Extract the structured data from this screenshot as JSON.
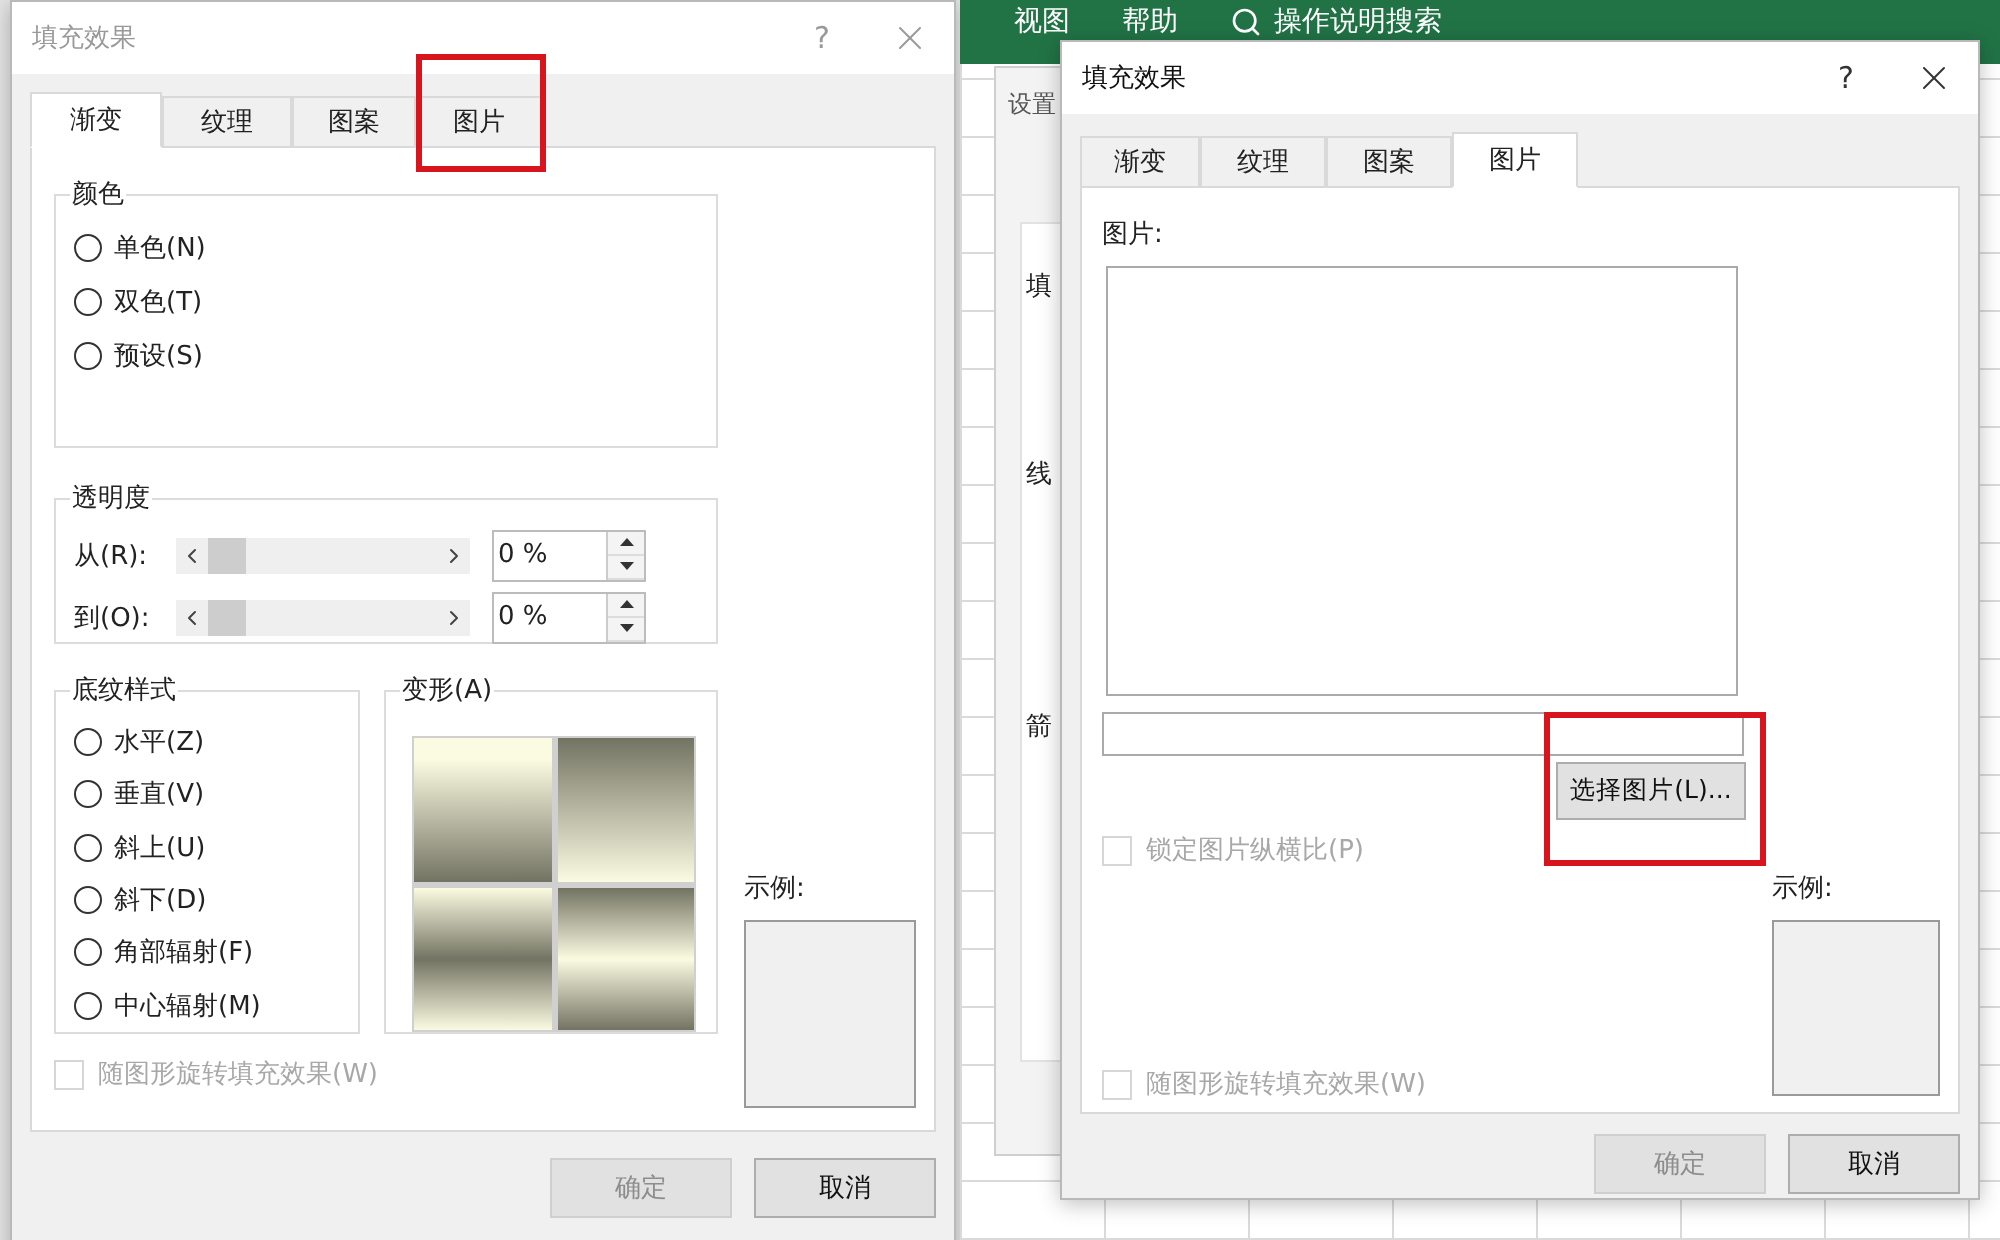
{
  "left_dialog": {
    "title": "填充效果",
    "active": false,
    "help": "?",
    "tabs": [
      {
        "label": "渐变",
        "selected": true,
        "highlighted": false
      },
      {
        "label": "纹理",
        "selected": false,
        "highlighted": false
      },
      {
        "label": "图案",
        "selected": false,
        "highlighted": false
      },
      {
        "label": "图片",
        "selected": false,
        "highlighted": true
      }
    ],
    "colors": {
      "title": "颜色",
      "options": [
        {
          "label": "单色(N)",
          "selected": false
        },
        {
          "label": "双色(T)",
          "selected": false
        },
        {
          "label": "预设(S)",
          "selected": false
        }
      ]
    },
    "transparency": {
      "title": "透明度",
      "rows": [
        {
          "label": "从(R):",
          "level": 0,
          "value": "0 %"
        },
        {
          "label": "到(O):",
          "level": 0,
          "value": "0 %"
        }
      ]
    },
    "shading_styles": {
      "title": "底纹样式",
      "options": [
        {
          "label": "水平(Z)",
          "selected": false
        },
        {
          "label": "垂直(V)",
          "selected": false
        },
        {
          "label": "斜上(U)",
          "selected": false
        },
        {
          "label": "斜下(D)",
          "selected": false
        },
        {
          "label": "角部辐射(F)",
          "selected": false
        },
        {
          "label": "中心辐射(M)",
          "selected": false
        }
      ]
    },
    "variants": {
      "title": "变形(A)"
    },
    "sample": {
      "label": "示例:"
    },
    "rotate_checkbox": {
      "label": "随图形旋转填充效果(W)",
      "checked": false,
      "disabled": true
    },
    "buttons": [
      {
        "label": "确定",
        "disabled": true
      },
      {
        "label": "取消",
        "disabled": false
      }
    ]
  },
  "background": {
    "ribbon_tabs": [
      "视图",
      "帮助"
    ],
    "search": "操作说明搜索",
    "back_dialog": {
      "title": "设置",
      "labels": [
        "填",
        "线",
        "箭"
      ]
    }
  },
  "right_dialog": {
    "title": "填充效果",
    "active": true,
    "help": "?",
    "tabs": [
      {
        "label": "渐变",
        "selected": false,
        "highlighted": false
      },
      {
        "label": "纹理",
        "selected": false,
        "highlighted": false
      },
      {
        "label": "图案",
        "selected": false,
        "highlighted": false
      },
      {
        "label": "图片",
        "selected": true,
        "highlighted": false
      }
    ],
    "picture_label": "图片:",
    "select_button": {
      "label": "选择图片(L)...",
      "highlighted": true
    },
    "lock_checkbox": {
      "label": "锁定图片纵横比(P)",
      "checked": false,
      "disabled": true
    },
    "sample": {
      "label": "示例:"
    },
    "rotate_checkbox": {
      "label": "随图形旋转填充效果(W)",
      "checked": false,
      "disabled": true
    },
    "buttons": [
      {
        "label": "确定",
        "disabled": true
      },
      {
        "label": "取消",
        "disabled": false
      }
    ]
  }
}
